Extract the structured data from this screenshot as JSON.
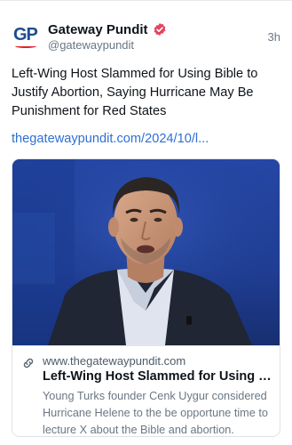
{
  "author": {
    "display_name": "Gateway Pundit",
    "handle": "@gatewaypundit",
    "avatar_text": "GP",
    "verified_badge_color": "#e3445f"
  },
  "post": {
    "time": "3h",
    "text": "Left-Wing Host Slammed for Using Bible to Justify Abortion, Saying Hurricane May Be Punishment for Red States",
    "link_text": "thegatewaypundit.com/2024/10/l..."
  },
  "card": {
    "domain": "www.thegatewaypundit.com",
    "title": "Left-Wing Host Slammed for Using Bi...",
    "description": "Young Turks founder Cenk Uygur considered Hurricane Helene to the be opportune time to lecture X about the Bible and abortion.",
    "image_icon": "video-still-man-speaking",
    "link_icon": "link-icon"
  },
  "colors": {
    "link": "#2f6fd6",
    "muted": "#687684",
    "card_background": "#1f3f97"
  }
}
